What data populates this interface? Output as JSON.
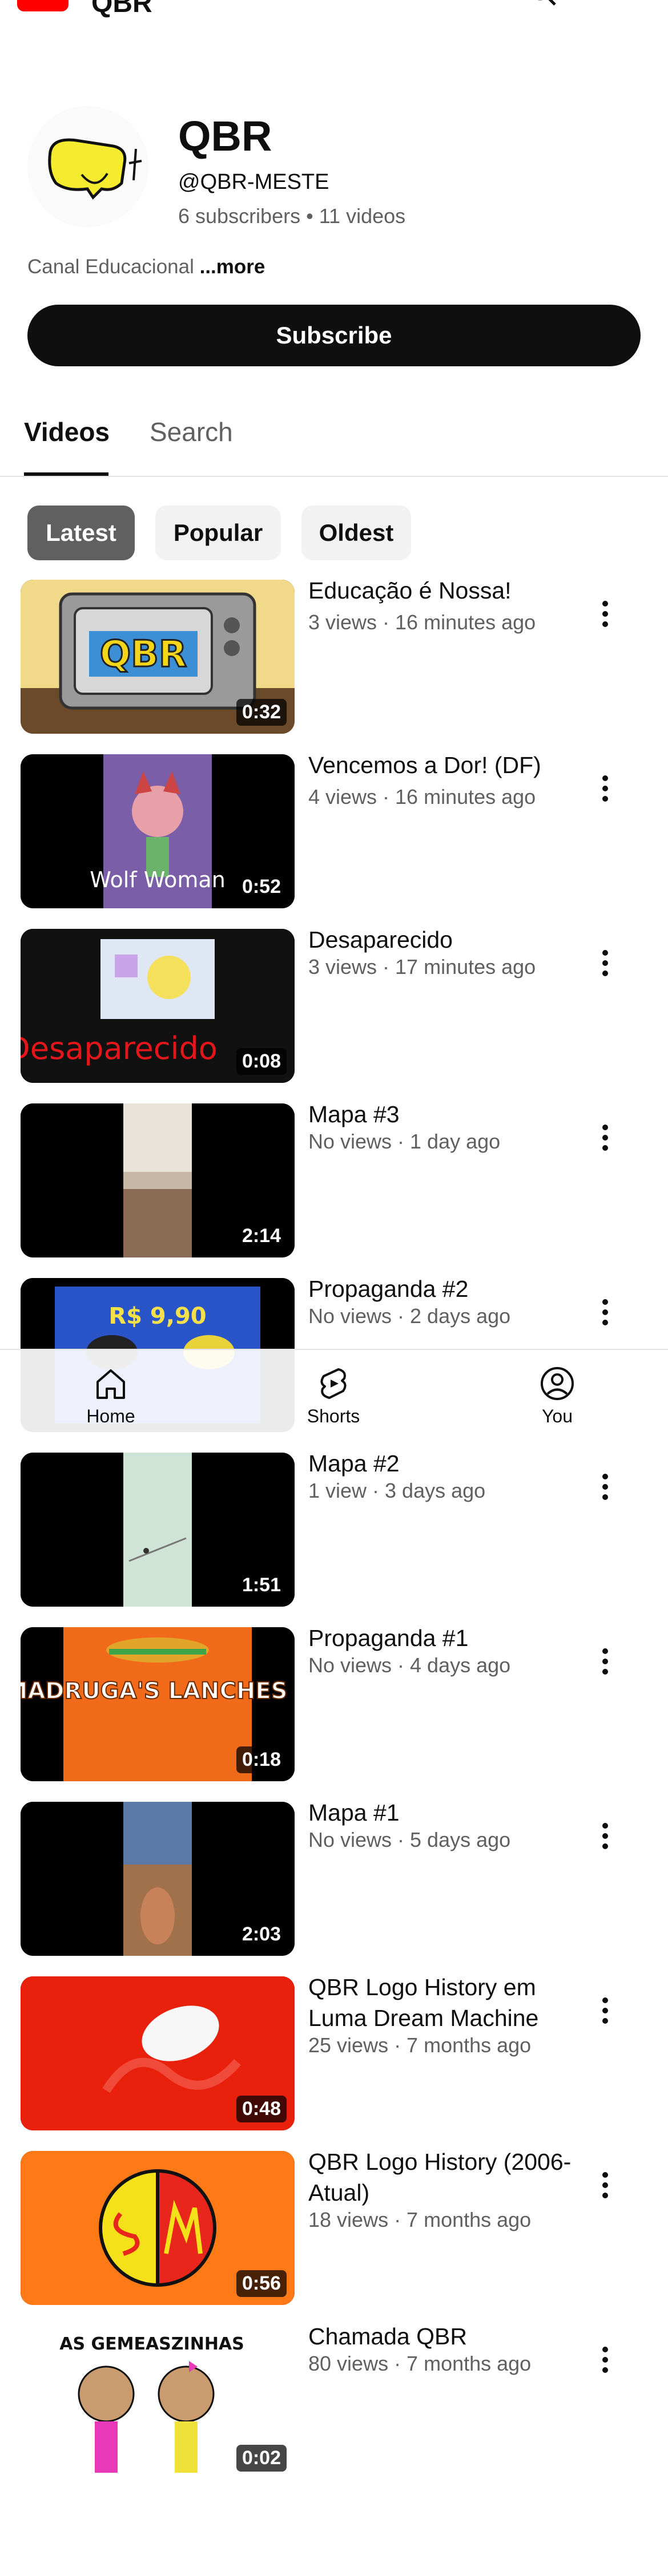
{
  "header": {
    "app_title": "QBR"
  },
  "channel": {
    "name": "QBR",
    "handle": "@QBR-MESTE",
    "stats": "6 subscribers • 11 videos",
    "description": "Canal Educacional",
    "more_label": "...more",
    "subscribe_label": "Subscribe"
  },
  "tabs": [
    {
      "label": "Videos",
      "active": true
    },
    {
      "label": "Search",
      "active": false
    }
  ],
  "chips": [
    {
      "label": "Latest",
      "selected": true
    },
    {
      "label": "Popular",
      "selected": false
    },
    {
      "label": "Oldest",
      "selected": false
    }
  ],
  "videos": [
    {
      "title": "Educação é Nossa!",
      "meta": "3 views · 16 minutes ago",
      "duration": "0:32"
    },
    {
      "title": "Vencemos a Dor! (DF)",
      "meta": "4 views · 16 minutes ago",
      "duration": "0:52",
      "overlay_text": "Wolf Woman"
    },
    {
      "title": "Desaparecido",
      "meta": "3 views · 17 minutes ago",
      "duration": "0:08",
      "overlay_text": "Desaparecido"
    },
    {
      "title": "Mapa #3",
      "meta": "No views · 1 day ago",
      "duration": "2:14"
    },
    {
      "title": "Propaganda #2",
      "meta": "No views · 2 days ago",
      "duration": "",
      "overlay_text": "R$ 9,90"
    },
    {
      "title": "Mapa #2",
      "meta": "1 view · 3 days ago",
      "duration": "1:51"
    },
    {
      "title": "Propaganda #1",
      "meta": "No views · 4 days ago",
      "duration": "0:18",
      "overlay_text": "MADRUGA'S LANCHES"
    },
    {
      "title": "Mapa #1",
      "meta": "No views · 5 days ago",
      "duration": "2:03"
    },
    {
      "title": "QBR Logo History em Luma Dream Machine",
      "meta": "25 views · 7 months ago",
      "duration": "0:48"
    },
    {
      "title": "QBR Logo History (2006-Atual)",
      "meta": "18 views · 7 months ago",
      "duration": "0:56"
    },
    {
      "title": "Chamada QBR",
      "meta": "80 views · 7 months ago",
      "duration": "0:02",
      "overlay_text": "AS GEMEASZINHAS"
    }
  ],
  "bottom_nav": [
    {
      "label": "Home",
      "icon": "home-icon"
    },
    {
      "label": "Shorts",
      "icon": "shorts-icon"
    },
    {
      "label": "You",
      "icon": "account-icon"
    }
  ],
  "colors": {
    "brand_red": "#ff0000",
    "text_primary": "#0f0f0f",
    "text_secondary": "#606060",
    "chip_bg": "#f2f2f2",
    "chip_selected": "#606060"
  }
}
